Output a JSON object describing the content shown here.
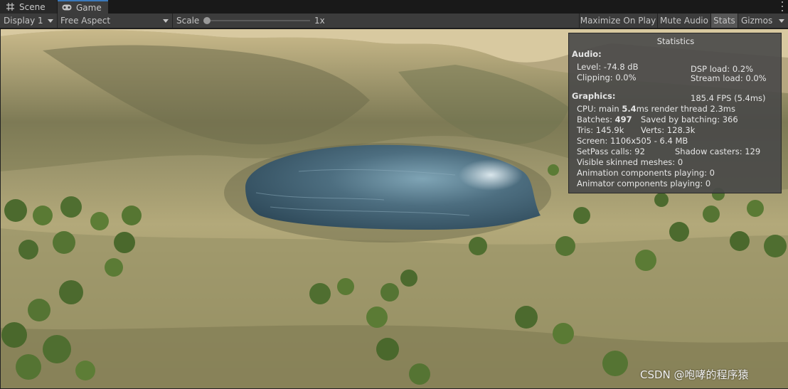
{
  "tabs": {
    "scene_label": "Scene",
    "game_label": "Game"
  },
  "toolbar": {
    "display": "Display 1",
    "aspect": "Free Aspect",
    "scale_label": "Scale",
    "scale_value": "1x",
    "scale_fraction": 0.0,
    "maximize_label": "Maximize On Play",
    "mute_label": "Mute Audio",
    "stats_label": "Stats",
    "gizmos_label": "Gizmos"
  },
  "stats": {
    "title": "Statistics",
    "audio_heading": "Audio:",
    "level": "Level: -74.8 dB",
    "dsp_load": "DSP load: 0.2%",
    "clipping": "Clipping: 0.0%",
    "stream_load": "Stream load: 0.0%",
    "graphics_heading": "Graphics:",
    "fps": "185.4 FPS (5.4ms)",
    "cpu_prefix": "CPU: main ",
    "cpu_main": "5.4",
    "cpu_suffix": "ms  render thread 2.3ms",
    "batches_prefix": "Batches: ",
    "batches": "497",
    "saved_batching": "Saved by batching: 366",
    "tris": "Tris: 145.9k",
    "verts": "Verts: 128.3k",
    "screen": "Screen: 1106x505 - 6.4 MB",
    "setpass": "SetPass calls: 92",
    "shadow_casters": "Shadow casters: 129",
    "skinned": "Visible skinned meshes: 0",
    "animation": "Animation components playing: 0",
    "animator": "Animator components playing: 0"
  },
  "watermark": "CSDN @咆哮的程序猿",
  "colors": {
    "tab_accent": "#3a79bb",
    "toolbar_bg": "#3c3c3c",
    "active_button": "#565656",
    "water": "#4a6a7c",
    "terrain": "#a89d6c"
  },
  "icons": {
    "scene": "grid-icon",
    "game": "gamepad-icon",
    "menu": "kebab-menu-icon"
  }
}
